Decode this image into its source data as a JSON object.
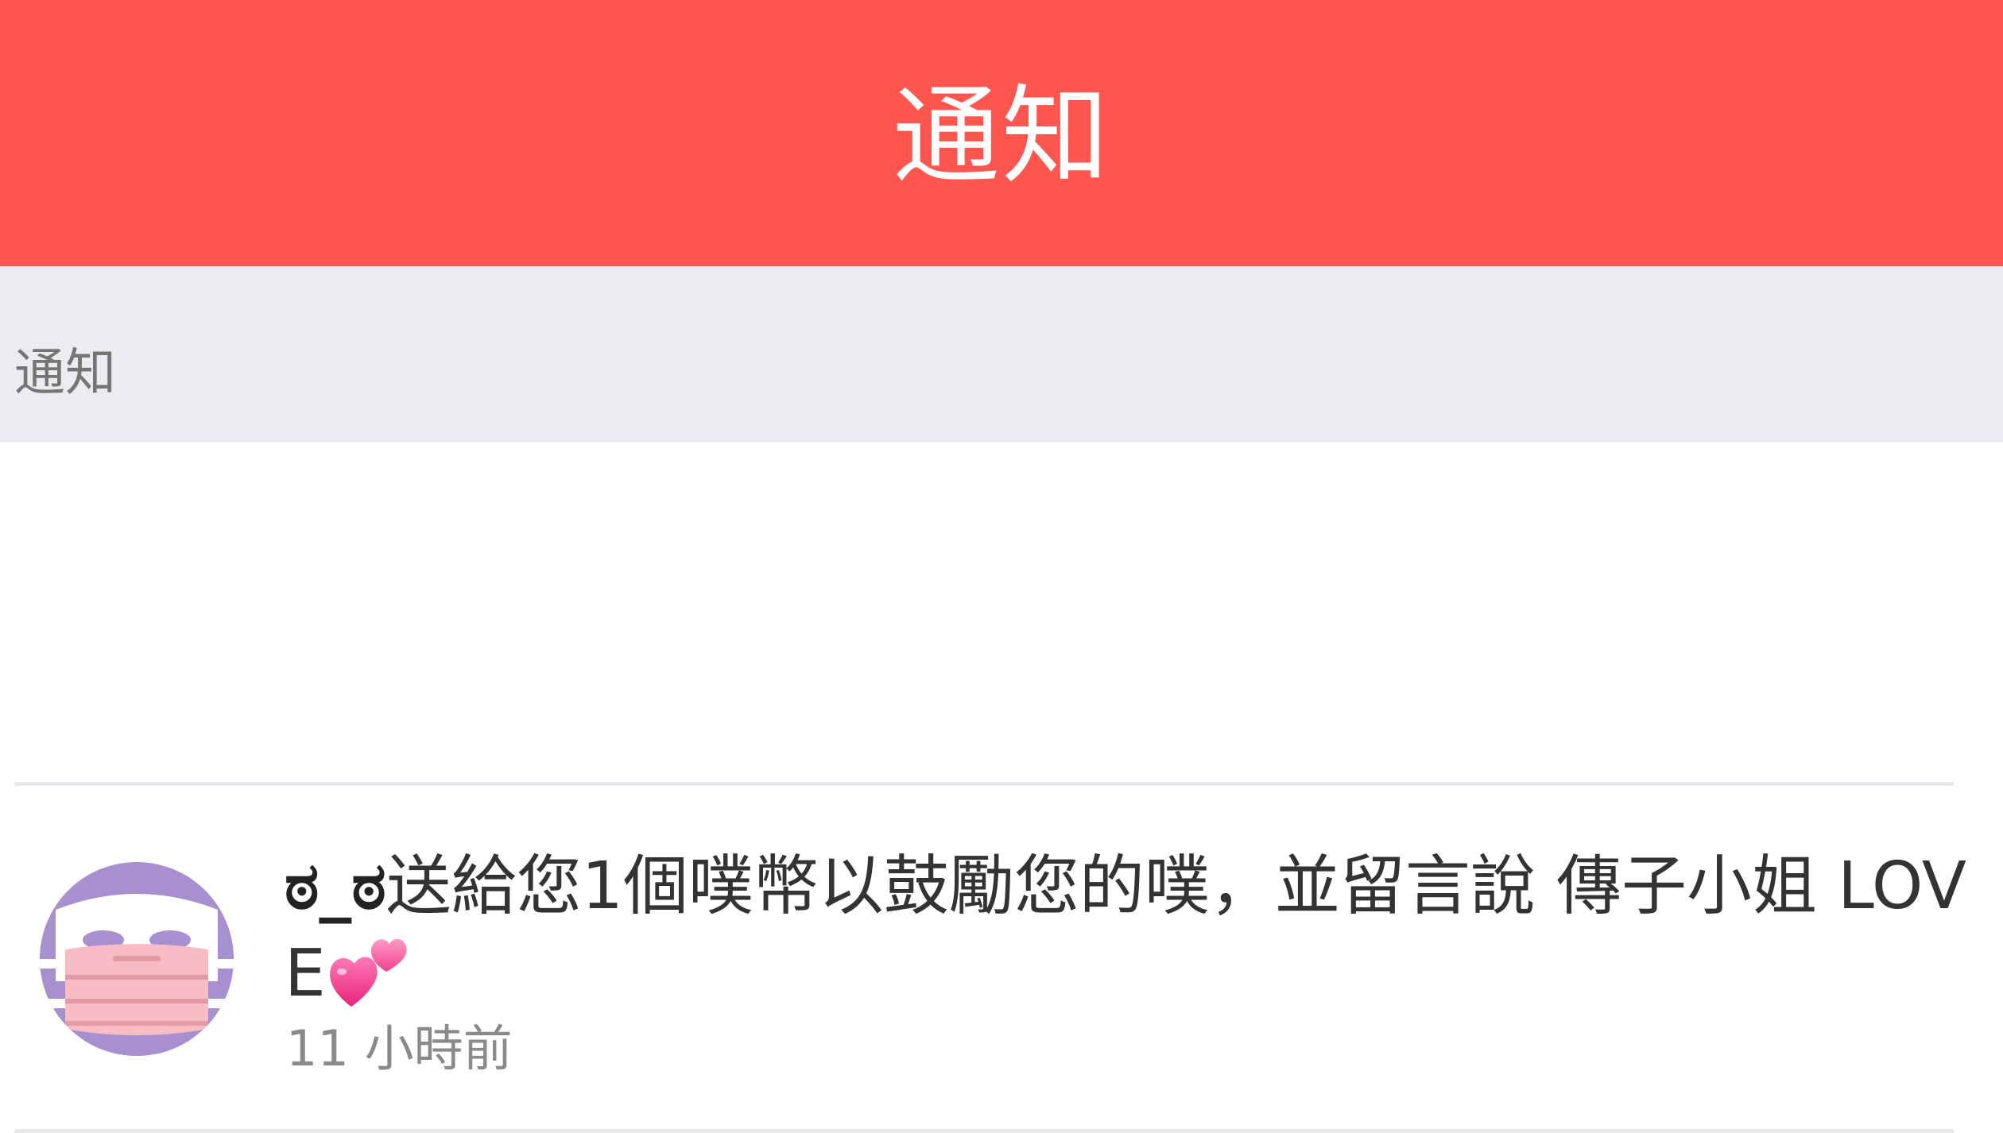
{
  "app_bar": {
    "title": "通知",
    "background_color": "#ff5650"
  },
  "section": {
    "label": "通知"
  },
  "notifications": [
    {
      "avatar_icon": "masked-face-avatar-icon",
      "sender": "ಠ_ಠ",
      "message": "送給您1個噗幣以鼓勵您的噗，並留言說 傳子小姐 LOVE",
      "emoji": "two-hearts-icon",
      "time": "11 小時前"
    }
  ]
}
